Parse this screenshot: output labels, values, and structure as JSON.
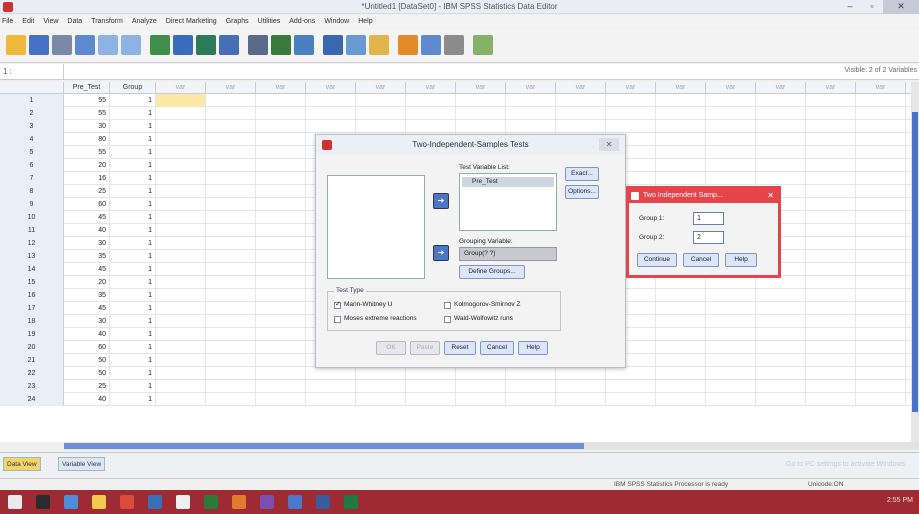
{
  "window": {
    "title": "*Untitled1 [DataSet0] - IBM SPSS Statistics Data Editor",
    "minimize": "–",
    "maximize": "▫",
    "close": "✕"
  },
  "menu": [
    "File",
    "Edit",
    "View",
    "Data",
    "Transform",
    "Analyze",
    "Direct Marketing",
    "Graphs",
    "Utilities",
    "Add-ons",
    "Window",
    "Help"
  ],
  "editbar": {
    "cell_ref": "1 :",
    "visible": "Visible: 2 of 2 Variables"
  },
  "grid": {
    "columns": [
      "Pre_Test",
      "Group",
      "var",
      "var",
      "var",
      "var",
      "var",
      "var",
      "var",
      "var",
      "var",
      "var",
      "var",
      "var",
      "var",
      "var",
      "var"
    ],
    "rows": [
      [
        "1",
        "55",
        "1"
      ],
      [
        "2",
        "55",
        "1"
      ],
      [
        "3",
        "30",
        "1"
      ],
      [
        "4",
        "80",
        "1"
      ],
      [
        "5",
        "55",
        "1"
      ],
      [
        "6",
        "20",
        "1"
      ],
      [
        "7",
        "16",
        "1"
      ],
      [
        "8",
        "25",
        "1"
      ],
      [
        "9",
        "60",
        "1"
      ],
      [
        "10",
        "45",
        "1"
      ],
      [
        "11",
        "40",
        "1"
      ],
      [
        "12",
        "30",
        "1"
      ],
      [
        "13",
        "35",
        "1"
      ],
      [
        "14",
        "45",
        "1"
      ],
      [
        "15",
        "20",
        "1"
      ],
      [
        "16",
        "35",
        "1"
      ],
      [
        "17",
        "45",
        "1"
      ],
      [
        "18",
        "30",
        "1"
      ],
      [
        "19",
        "40",
        "1"
      ],
      [
        "20",
        "60",
        "1"
      ],
      [
        "21",
        "50",
        "1"
      ],
      [
        "22",
        "50",
        "1"
      ],
      [
        "23",
        "25",
        "1"
      ],
      [
        "24",
        "40",
        "1"
      ]
    ]
  },
  "tabs": {
    "data_view": "Data View",
    "variable_view": "Variable View",
    "ghost": "Go to PC settings to activate Windows."
  },
  "status": {
    "processor": "IBM SPSS Statistics Processor is ready",
    "encoding": "Unicode:ON"
  },
  "taskbar": {
    "clock": "2:55 PM"
  },
  "dialog": {
    "title": "Two-Independent-Samples Tests",
    "close": "✕",
    "test_variable_label": "Test Variable List:",
    "test_variable": "Pre_Test",
    "grouping_label": "Grouping Variable:",
    "grouping_value": "Group(? ?)",
    "define_groups": "Define Groups...",
    "exact": "Exact...",
    "options": "Options...",
    "test_type_label": "Test Type",
    "mann_whitney": "Mann-Whitney U",
    "kolmogorov": "Kolmogorov-Smirnov Z",
    "moses": "Moses extreme reactions",
    "wald": "Wald-Wolfowitz runs",
    "ok": "OK",
    "paste": "Paste",
    "reset": "Reset",
    "cancel": "Cancel",
    "help": "Help",
    "arrow": "➔"
  },
  "subdialog": {
    "title": "Two Independent Samp...",
    "close": "✕",
    "group1_label": "Group 1:",
    "group1_value": "1",
    "group2_label": "Group 2:",
    "group2_value": "2",
    "continue": "Continue",
    "cancel": "Cancel",
    "help": "Help"
  }
}
